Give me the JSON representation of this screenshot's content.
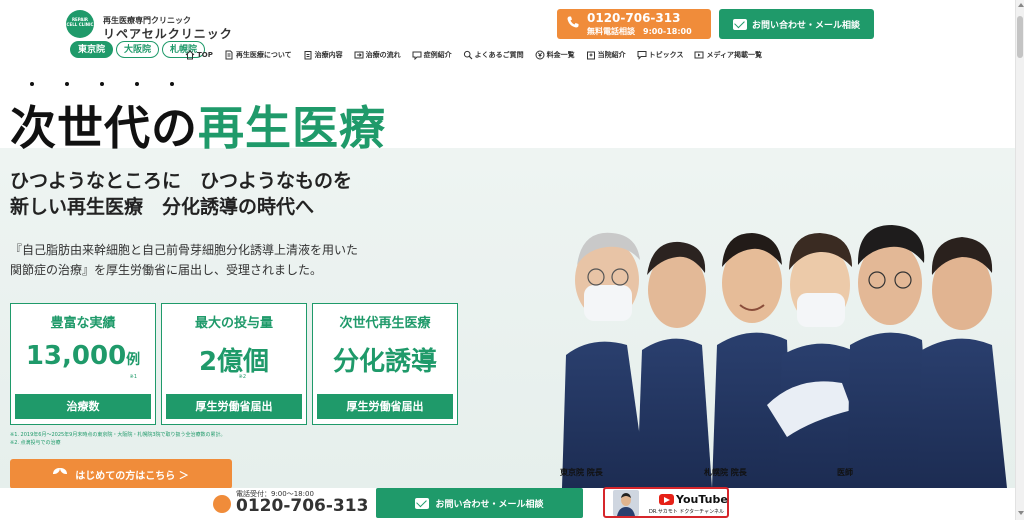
{
  "header": {
    "logo_text": "REPAIR CELL CLINIC",
    "brand_sub": "再生医療専門クリニック",
    "brand_name": "リペアセルクリニック",
    "branches": [
      "東京院",
      "大阪院",
      "札幌院"
    ],
    "nav": [
      {
        "label": "TOP",
        "icon": "home-icon"
      },
      {
        "label": "再生医療について",
        "icon": "document-icon"
      },
      {
        "label": "治療内容",
        "icon": "clipboard-icon"
      },
      {
        "label": "治療の流れ",
        "icon": "flow-icon"
      },
      {
        "label": "症例紹介",
        "icon": "case-icon"
      },
      {
        "label": "よくあるご質問",
        "icon": "search-icon"
      },
      {
        "label": "料金一覧",
        "icon": "yen-icon"
      },
      {
        "label": "当院紹介",
        "icon": "hospital-icon"
      },
      {
        "label": "トピックス",
        "icon": "chat-icon"
      },
      {
        "label": "メディア掲載一覧",
        "icon": "media-icon"
      }
    ],
    "phone_number": "0120-706-313",
    "phone_sub": "無料電話相談　9:00-18:00",
    "mail_label": "お問い合わせ・メール相談"
  },
  "hero": {
    "headline_black": "次世代の",
    "headline_green": "再生医療",
    "sub1": "ひつようなところに　ひつようなものを",
    "sub2": "新しい再生医療　分化誘導の時代へ",
    "desc1": "『自己脂肪由来幹細胞と自己前骨芽細胞分化誘導上清液を用いた",
    "desc2": "関節症の治療』を厚生労働省に届出し、受理されました。",
    "stats": [
      {
        "title": "豊富な実績",
        "value": "13,000",
        "unit": "例",
        "note": "※1",
        "foot": "治療数"
      },
      {
        "title": "最大の投与量",
        "value": "2億個",
        "unit": "",
        "note": "※2",
        "foot": "厚生労働省届出"
      },
      {
        "title": "次世代再生医療",
        "value": "分化誘導",
        "unit": "",
        "note": "",
        "foot": "厚生労働省届出"
      }
    ],
    "footnote1": "※1. 2019年6月〜2025年9月末時点の東京院・大阪院・札幌院3院で取り扱う全治療数の累計。",
    "footnote2": "※2. 点滴投与での治療",
    "first_time_label": "はじめての方はこちら ＞",
    "doctor_labels": [
      "東京院 院長",
      "札幌院 院長",
      "医師"
    ]
  },
  "bottom_bar": {
    "phone_label": "電話受付：9:00〜18:00",
    "phone_number": "0120-706-313",
    "mail_label": "お問い合わせ・メール相談",
    "youtube_logo": "YouTube",
    "youtube_caption": "DR.サカモト ドクターチャンネル"
  },
  "colors": {
    "brand_green": "#1f9a6a",
    "accent_orange": "#f08c3a",
    "youtube_red": "#e62117"
  }
}
